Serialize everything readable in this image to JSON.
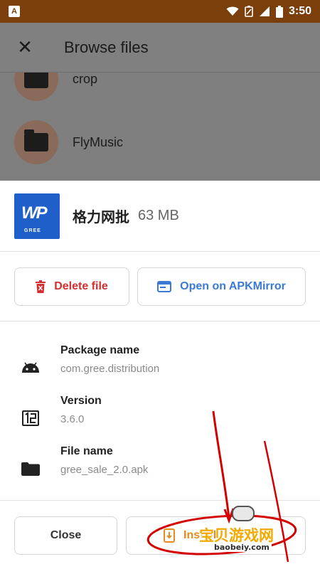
{
  "status_bar": {
    "time": "3:50",
    "notification_icon_glyph": "A",
    "icons": [
      "wifi-icon",
      "battery-saver-icon",
      "signal-icon",
      "battery-icon"
    ]
  },
  "background_screen": {
    "title": "Browse files",
    "close_icon": "close-icon",
    "rows": [
      {
        "name": "crop",
        "icon": "folder-icon"
      },
      {
        "name": "FlyMusic",
        "icon": "folder-icon"
      }
    ]
  },
  "sheet": {
    "app_name": "格力网批",
    "app_size": "63 MB",
    "logo_text": "WP",
    "logo_brand": "GREE",
    "delete_label": "Delete file",
    "open_label": "Open on APKMirror",
    "details": [
      {
        "label": "Package name",
        "value": "com.gree.distribution",
        "icon": "android-icon"
      },
      {
        "label": "Version",
        "value": "3.6.0",
        "icon": "version-icon"
      },
      {
        "label": "File name",
        "value": "gree_sale_2.0.apk",
        "icon": "folder-icon"
      }
    ],
    "close_label": "Close",
    "install_label": "Install"
  },
  "watermark": {
    "chinese": "宝贝游戏网",
    "domain": "baobeiy.com"
  },
  "colors": {
    "status_bar": "#7a3f0a",
    "delete": "#d32f2f",
    "open": "#3a7ad6",
    "install": "#e98b1c",
    "annotation": "#d40000"
  }
}
